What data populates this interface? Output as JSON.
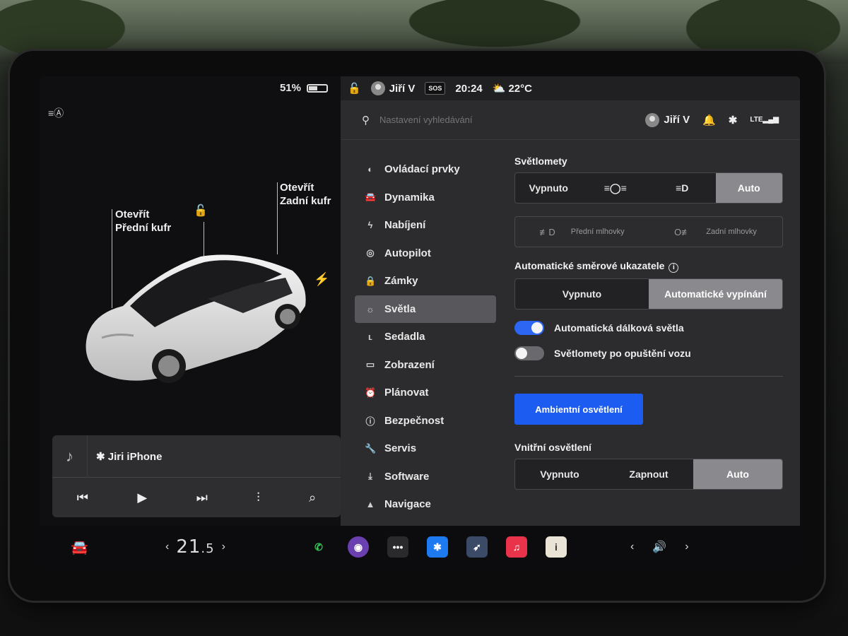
{
  "left": {
    "battery_percent": "51%",
    "battery_level": 0.51,
    "callout_front": [
      "Otevřít",
      "Přední kufr"
    ],
    "callout_rear": [
      "Otevřít",
      "Zadní kufr"
    ]
  },
  "media": {
    "source": "✱ Jiri iPhone"
  },
  "status": {
    "user": "Jiří V",
    "sos": "SOS",
    "time": "20:24",
    "temperature": "22°C"
  },
  "search": {
    "placeholder": "Nastavení vyhledávání",
    "user": "Jiří V"
  },
  "nav": [
    {
      "label": "Ovládací prvky",
      "icon": "toggle-icon"
    },
    {
      "label": "Dynamika",
      "icon": "car-icon"
    },
    {
      "label": "Nabíjení",
      "icon": "bolt-icon"
    },
    {
      "label": "Autopilot",
      "icon": "steering-wheel-icon"
    },
    {
      "label": "Zámky",
      "icon": "lock-icon"
    },
    {
      "label": "Světla",
      "icon": "sun-icon",
      "active": true
    },
    {
      "label": "Sedadla",
      "icon": "seat-icon"
    },
    {
      "label": "Zobrazení",
      "icon": "display-icon"
    },
    {
      "label": "Plánovat",
      "icon": "alarm-icon"
    },
    {
      "label": "Bezpečnost",
      "icon": "info-icon"
    },
    {
      "label": "Servis",
      "icon": "wrench-icon"
    },
    {
      "label": "Software",
      "icon": "download-icon"
    },
    {
      "label": "Navigace",
      "icon": "navigation-icon"
    }
  ],
  "lights": {
    "headlights_title": "Světlomety",
    "headlights": [
      "Vypnuto",
      "Auto"
    ],
    "headlights_selected": "Auto",
    "fog_front": "Přední mlhovky",
    "fog_rear": "Zadní mlhovky",
    "turn_signal_title": "Automatické směrové ukazatele",
    "turn_signal": [
      "Vypnuto",
      "Automatické vypínání"
    ],
    "turn_signal_selected": "Automatické vypínání",
    "auto_high_beam": "Automatická dálková světla",
    "auto_high_beam_on": true,
    "headlights_after_exit": "Světlomety po opuštění vozu",
    "headlights_after_exit_on": false,
    "ambient_button": "Ambientní osvětlení",
    "interior_title": "Vnitřní osvětlení",
    "interior": [
      "Vypnuto",
      "Zapnout",
      "Auto"
    ],
    "interior_selected": "Auto"
  },
  "bottom": {
    "temp_int": "21",
    "temp_dec": ".5"
  },
  "colors": {
    "accent_blue": "#1d5cf0",
    "toggle_on": "#2c66f2",
    "toggle_off": "#6a6a6e",
    "call_green": "#35c759",
    "music_red": "#e8334a",
    "bluetooth_blue": "#1e7af0"
  }
}
